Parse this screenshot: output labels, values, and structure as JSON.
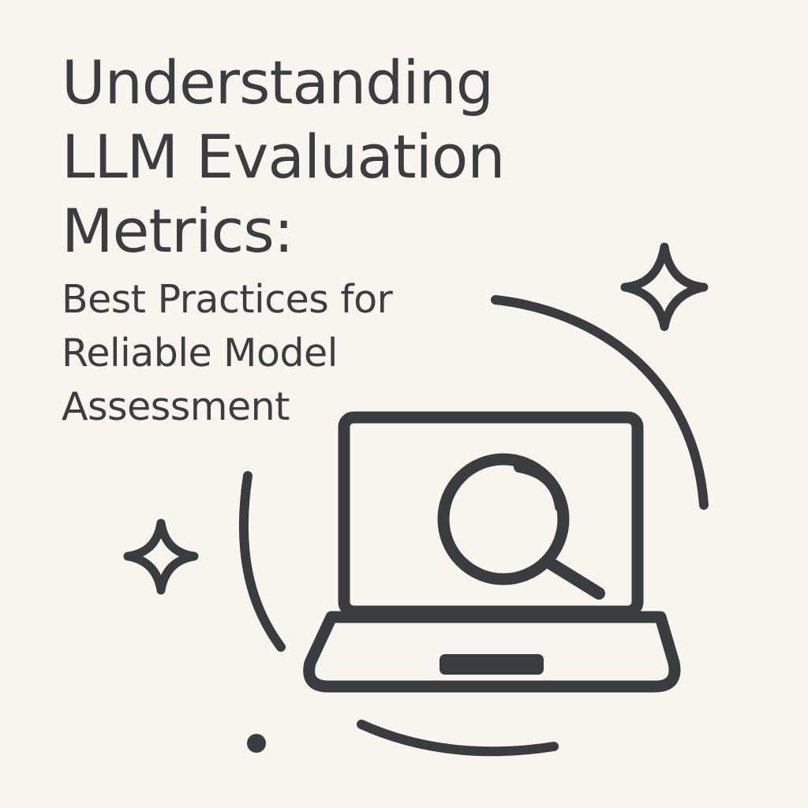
{
  "title": {
    "line1": "Understanding",
    "line2": "LLM Evaluation",
    "line3": "Metrics:"
  },
  "subtitle": {
    "line1": "Best Practices for",
    "line2": "Reliable Model",
    "line3": "Assessment"
  },
  "colors": {
    "background": "#f8f5ee",
    "ink": "#3a3d40"
  },
  "icons": [
    "laptop-icon",
    "magnifying-glass-icon",
    "sparkle-icon"
  ]
}
